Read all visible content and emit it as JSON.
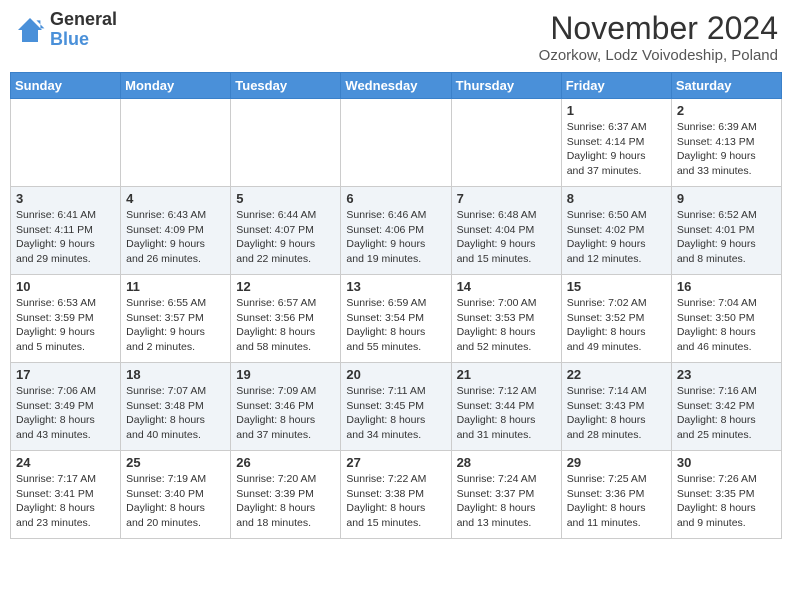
{
  "header": {
    "logo_line1": "General",
    "logo_line2": "Blue",
    "month_title": "November 2024",
    "subtitle": "Ozorkow, Lodz Voivodeship, Poland"
  },
  "days_of_week": [
    "Sunday",
    "Monday",
    "Tuesday",
    "Wednesday",
    "Thursday",
    "Friday",
    "Saturday"
  ],
  "weeks": [
    [
      {
        "day": "",
        "info": ""
      },
      {
        "day": "",
        "info": ""
      },
      {
        "day": "",
        "info": ""
      },
      {
        "day": "",
        "info": ""
      },
      {
        "day": "",
        "info": ""
      },
      {
        "day": "1",
        "info": "Sunrise: 6:37 AM\nSunset: 4:14 PM\nDaylight: 9 hours and 37 minutes."
      },
      {
        "day": "2",
        "info": "Sunrise: 6:39 AM\nSunset: 4:13 PM\nDaylight: 9 hours and 33 minutes."
      }
    ],
    [
      {
        "day": "3",
        "info": "Sunrise: 6:41 AM\nSunset: 4:11 PM\nDaylight: 9 hours and 29 minutes."
      },
      {
        "day": "4",
        "info": "Sunrise: 6:43 AM\nSunset: 4:09 PM\nDaylight: 9 hours and 26 minutes."
      },
      {
        "day": "5",
        "info": "Sunrise: 6:44 AM\nSunset: 4:07 PM\nDaylight: 9 hours and 22 minutes."
      },
      {
        "day": "6",
        "info": "Sunrise: 6:46 AM\nSunset: 4:06 PM\nDaylight: 9 hours and 19 minutes."
      },
      {
        "day": "7",
        "info": "Sunrise: 6:48 AM\nSunset: 4:04 PM\nDaylight: 9 hours and 15 minutes."
      },
      {
        "day": "8",
        "info": "Sunrise: 6:50 AM\nSunset: 4:02 PM\nDaylight: 9 hours and 12 minutes."
      },
      {
        "day": "9",
        "info": "Sunrise: 6:52 AM\nSunset: 4:01 PM\nDaylight: 9 hours and 8 minutes."
      }
    ],
    [
      {
        "day": "10",
        "info": "Sunrise: 6:53 AM\nSunset: 3:59 PM\nDaylight: 9 hours and 5 minutes."
      },
      {
        "day": "11",
        "info": "Sunrise: 6:55 AM\nSunset: 3:57 PM\nDaylight: 9 hours and 2 minutes."
      },
      {
        "day": "12",
        "info": "Sunrise: 6:57 AM\nSunset: 3:56 PM\nDaylight: 8 hours and 58 minutes."
      },
      {
        "day": "13",
        "info": "Sunrise: 6:59 AM\nSunset: 3:54 PM\nDaylight: 8 hours and 55 minutes."
      },
      {
        "day": "14",
        "info": "Sunrise: 7:00 AM\nSunset: 3:53 PM\nDaylight: 8 hours and 52 minutes."
      },
      {
        "day": "15",
        "info": "Sunrise: 7:02 AM\nSunset: 3:52 PM\nDaylight: 8 hours and 49 minutes."
      },
      {
        "day": "16",
        "info": "Sunrise: 7:04 AM\nSunset: 3:50 PM\nDaylight: 8 hours and 46 minutes."
      }
    ],
    [
      {
        "day": "17",
        "info": "Sunrise: 7:06 AM\nSunset: 3:49 PM\nDaylight: 8 hours and 43 minutes."
      },
      {
        "day": "18",
        "info": "Sunrise: 7:07 AM\nSunset: 3:48 PM\nDaylight: 8 hours and 40 minutes."
      },
      {
        "day": "19",
        "info": "Sunrise: 7:09 AM\nSunset: 3:46 PM\nDaylight: 8 hours and 37 minutes."
      },
      {
        "day": "20",
        "info": "Sunrise: 7:11 AM\nSunset: 3:45 PM\nDaylight: 8 hours and 34 minutes."
      },
      {
        "day": "21",
        "info": "Sunrise: 7:12 AM\nSunset: 3:44 PM\nDaylight: 8 hours and 31 minutes."
      },
      {
        "day": "22",
        "info": "Sunrise: 7:14 AM\nSunset: 3:43 PM\nDaylight: 8 hours and 28 minutes."
      },
      {
        "day": "23",
        "info": "Sunrise: 7:16 AM\nSunset: 3:42 PM\nDaylight: 8 hours and 25 minutes."
      }
    ],
    [
      {
        "day": "24",
        "info": "Sunrise: 7:17 AM\nSunset: 3:41 PM\nDaylight: 8 hours and 23 minutes."
      },
      {
        "day": "25",
        "info": "Sunrise: 7:19 AM\nSunset: 3:40 PM\nDaylight: 8 hours and 20 minutes."
      },
      {
        "day": "26",
        "info": "Sunrise: 7:20 AM\nSunset: 3:39 PM\nDaylight: 8 hours and 18 minutes."
      },
      {
        "day": "27",
        "info": "Sunrise: 7:22 AM\nSunset: 3:38 PM\nDaylight: 8 hours and 15 minutes."
      },
      {
        "day": "28",
        "info": "Sunrise: 7:24 AM\nSunset: 3:37 PM\nDaylight: 8 hours and 13 minutes."
      },
      {
        "day": "29",
        "info": "Sunrise: 7:25 AM\nSunset: 3:36 PM\nDaylight: 8 hours and 11 minutes."
      },
      {
        "day": "30",
        "info": "Sunrise: 7:26 AM\nSunset: 3:35 PM\nDaylight: 8 hours and 9 minutes."
      }
    ]
  ]
}
